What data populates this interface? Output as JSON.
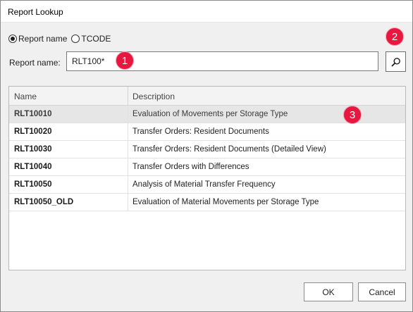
{
  "window": {
    "title": "Report Lookup"
  },
  "search_mode": {
    "options": [
      {
        "label": "Report name",
        "selected": true
      },
      {
        "label": "TCODE",
        "selected": false
      }
    ]
  },
  "search": {
    "label": "Report name:",
    "value": "RLT100*",
    "button_icon": "magnifier-icon"
  },
  "callouts": [
    "1",
    "2",
    "3"
  ],
  "callout_color": "#e8173f",
  "results": {
    "columns": [
      "Name",
      "Description"
    ],
    "rows": [
      {
        "name": "RLT10010",
        "description": "Evaluation of Movements per Storage Type",
        "selected": true
      },
      {
        "name": "RLT10020",
        "description": "Transfer Orders: Resident Documents",
        "selected": false
      },
      {
        "name": "RLT10030",
        "description": "Transfer Orders: Resident Documents (Detailed View)",
        "selected": false
      },
      {
        "name": "RLT10040",
        "description": "Transfer Orders with Differences",
        "selected": false
      },
      {
        "name": "RLT10050",
        "description": "Analysis of Material Transfer Frequency",
        "selected": false
      },
      {
        "name": "RLT10050_OLD",
        "description": "Evaluation of Material Movements per Storage Type",
        "selected": false
      }
    ]
  },
  "footer": {
    "ok_label": "OK",
    "cancel_label": "Cancel"
  }
}
